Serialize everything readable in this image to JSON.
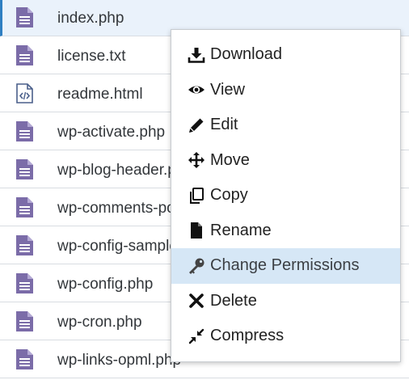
{
  "files": [
    {
      "name": "index.php",
      "icon": "document-icon",
      "selected": true
    },
    {
      "name": "license.txt",
      "icon": "document-icon"
    },
    {
      "name": "readme.html",
      "icon": "html-file-icon"
    },
    {
      "name": "wp-activate.php",
      "icon": "document-icon"
    },
    {
      "name": "wp-blog-header.php",
      "icon": "document-icon"
    },
    {
      "name": "wp-comments-post.php",
      "icon": "document-icon"
    },
    {
      "name": "wp-config-sample.php",
      "icon": "document-icon"
    },
    {
      "name": "wp-config.php",
      "icon": "document-icon"
    },
    {
      "name": "wp-cron.php",
      "icon": "document-icon"
    },
    {
      "name": "wp-links-opml.php",
      "icon": "document-icon"
    }
  ],
  "context_menu": {
    "items": [
      {
        "label": "Download",
        "icon": "download-icon"
      },
      {
        "label": "View",
        "icon": "eye-icon"
      },
      {
        "label": "Edit",
        "icon": "pencil-icon"
      },
      {
        "label": "Move",
        "icon": "move-arrows-icon"
      },
      {
        "label": "Copy",
        "icon": "copy-icon"
      },
      {
        "label": "Rename",
        "icon": "file-icon"
      },
      {
        "label": "Change Permissions",
        "icon": "key-icon",
        "highlighted": true
      },
      {
        "label": "Delete",
        "icon": "x-icon"
      },
      {
        "label": "Compress",
        "icon": "compress-icon"
      }
    ]
  },
  "colors": {
    "file_icon": "#7b6ca8",
    "selected_row": "#eaf2fb",
    "selected_border": "#2f7fc2",
    "menu_highlight": "#d6e7f6"
  }
}
